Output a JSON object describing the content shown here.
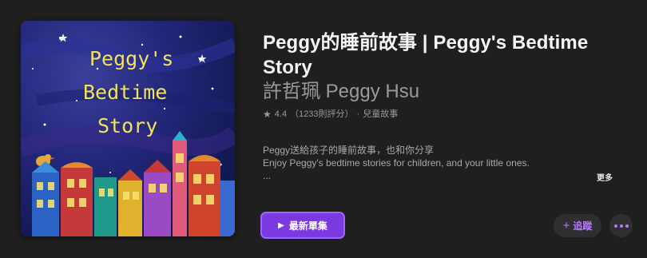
{
  "podcast": {
    "title": "Peggy的睡前故事 | Peggy's Bedtime Story",
    "author": "許哲珮 Peggy Hsu",
    "rating": "4.4",
    "rating_count": "（1233則評分）",
    "separator": "·",
    "category": "兒童故事",
    "description_line1": "Peggy送給孩子的睡前故事，也和你分享",
    "description_line2": "Enjoy Peggy's bedtime stories for children, and your little ones.",
    "description_line3": "...",
    "more_label": "更多"
  },
  "cover": {
    "line1": "Peggy's",
    "line2": "Bedtime",
    "line3": "Story"
  },
  "actions": {
    "play_label": "最新單集",
    "follow_label": "追蹤"
  },
  "colors": {
    "accent": "#7a3ae0",
    "accent_light": "#b87bff",
    "background": "#1f1f1f"
  },
  "icons": {
    "star": "star-icon",
    "play": "play-icon",
    "plus": "plus-icon",
    "more": "more-dots-icon"
  }
}
